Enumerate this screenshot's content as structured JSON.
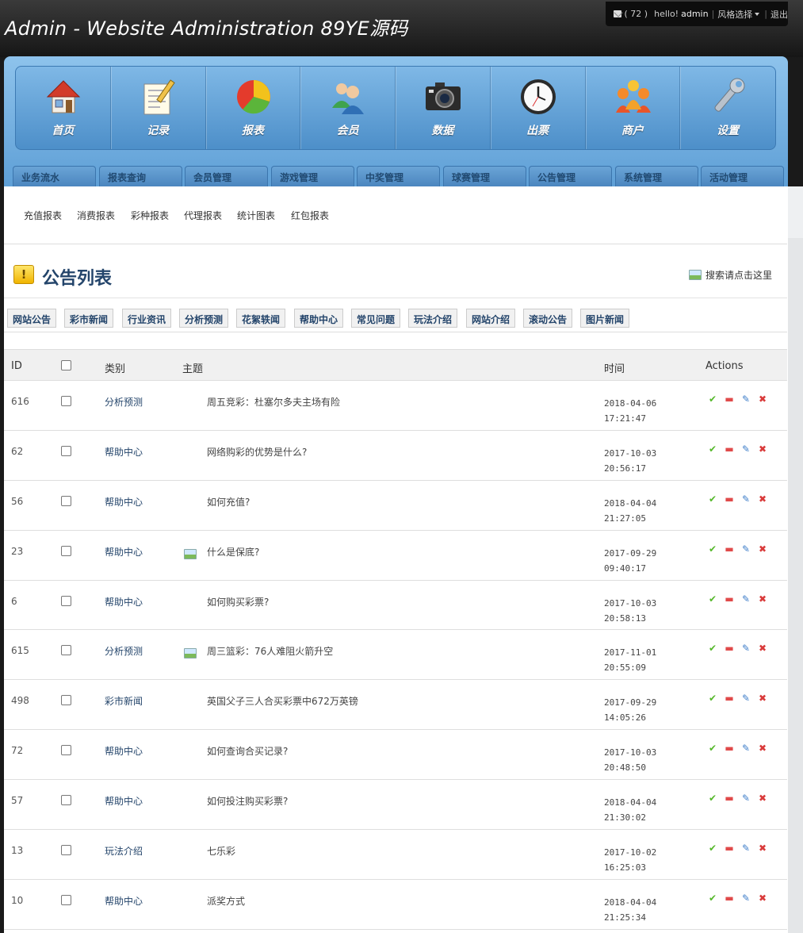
{
  "header": {
    "site_title": "Admin - Website Administration 89YE源码",
    "message_count": "( 72 )",
    "greeting": "hello!",
    "username": "admin",
    "style_select": "风格选择",
    "logout": "退出"
  },
  "main_nav": [
    {
      "label": "首页",
      "icon": "home-icon"
    },
    {
      "label": "记录",
      "icon": "notepad-icon"
    },
    {
      "label": "报表",
      "icon": "pie-chart-icon"
    },
    {
      "label": "会员",
      "icon": "users-icon"
    },
    {
      "label": "数据",
      "icon": "camera-icon"
    },
    {
      "label": "出票",
      "icon": "clock-icon"
    },
    {
      "label": "商户",
      "icon": "people-group-icon"
    },
    {
      "label": "设置",
      "icon": "wrench-icon"
    }
  ],
  "sub_tabs": [
    "业务流水",
    "报表查询",
    "会员管理",
    "游戏管理",
    "中奖管理",
    "球赛管理",
    "公告管理",
    "系统管理",
    "活动管理"
  ],
  "report_links": [
    "充值报表",
    "消费报表",
    "彩种报表",
    "代理报表",
    "统计图表",
    "红包报表"
  ],
  "page": {
    "title": "公告列表",
    "search_link": "搜索请点击这里"
  },
  "category_tabs": [
    "网站公告",
    "彩市新闻",
    "行业资讯",
    "分析预测",
    "花絮轶闻",
    "帮助中心",
    "常见问题",
    "玩法介绍",
    "网站介绍",
    "滚动公告",
    "图片新闻"
  ],
  "table": {
    "headers": {
      "id": "ID",
      "category": "类别",
      "subject": "主题",
      "time": "时间",
      "actions": "Actions"
    },
    "rows": [
      {
        "id": "616",
        "category": "分析预测",
        "subject": "周五竞彩：杜塞尔多夫主场有险",
        "has_image": false,
        "date": "2018-04-06",
        "clock": "17:21:47"
      },
      {
        "id": "62",
        "category": "帮助中心",
        "subject": "网络购彩的优势是什么?",
        "has_image": false,
        "date": "2017-10-03",
        "clock": "20:56:17"
      },
      {
        "id": "56",
        "category": "帮助中心",
        "subject": "如何充值?",
        "has_image": false,
        "date": "2018-04-04",
        "clock": "21:27:05"
      },
      {
        "id": "23",
        "category": "帮助中心",
        "subject": "什么是保底?",
        "has_image": true,
        "date": "2017-09-29",
        "clock": "09:40:17"
      },
      {
        "id": "6",
        "category": "帮助中心",
        "subject": "如何购买彩票?",
        "has_image": false,
        "date": "2017-10-03",
        "clock": "20:58:13"
      },
      {
        "id": "615",
        "category": "分析预测",
        "subject": "周三篮彩：76人难阻火箭升空",
        "has_image": true,
        "date": "2017-11-01",
        "clock": "20:55:09"
      },
      {
        "id": "498",
        "category": "彩市新闻",
        "subject": "英国父子三人合买彩票中672万英镑",
        "has_image": false,
        "date": "2017-09-29",
        "clock": "14:05:26"
      },
      {
        "id": "72",
        "category": "帮助中心",
        "subject": "如何查询合买记录?",
        "has_image": false,
        "date": "2017-10-03",
        "clock": "20:48:50"
      },
      {
        "id": "57",
        "category": "帮助中心",
        "subject": "如何投注购买彩票?",
        "has_image": false,
        "date": "2018-04-04",
        "clock": "21:30:02"
      },
      {
        "id": "13",
        "category": "玩法介绍",
        "subject": "七乐彩",
        "has_image": false,
        "date": "2017-10-02",
        "clock": "16:25:03"
      },
      {
        "id": "10",
        "category": "帮助中心",
        "subject": "派奖方式",
        "has_image": false,
        "date": "2018-04-04",
        "clock": "21:25:34"
      }
    ]
  }
}
